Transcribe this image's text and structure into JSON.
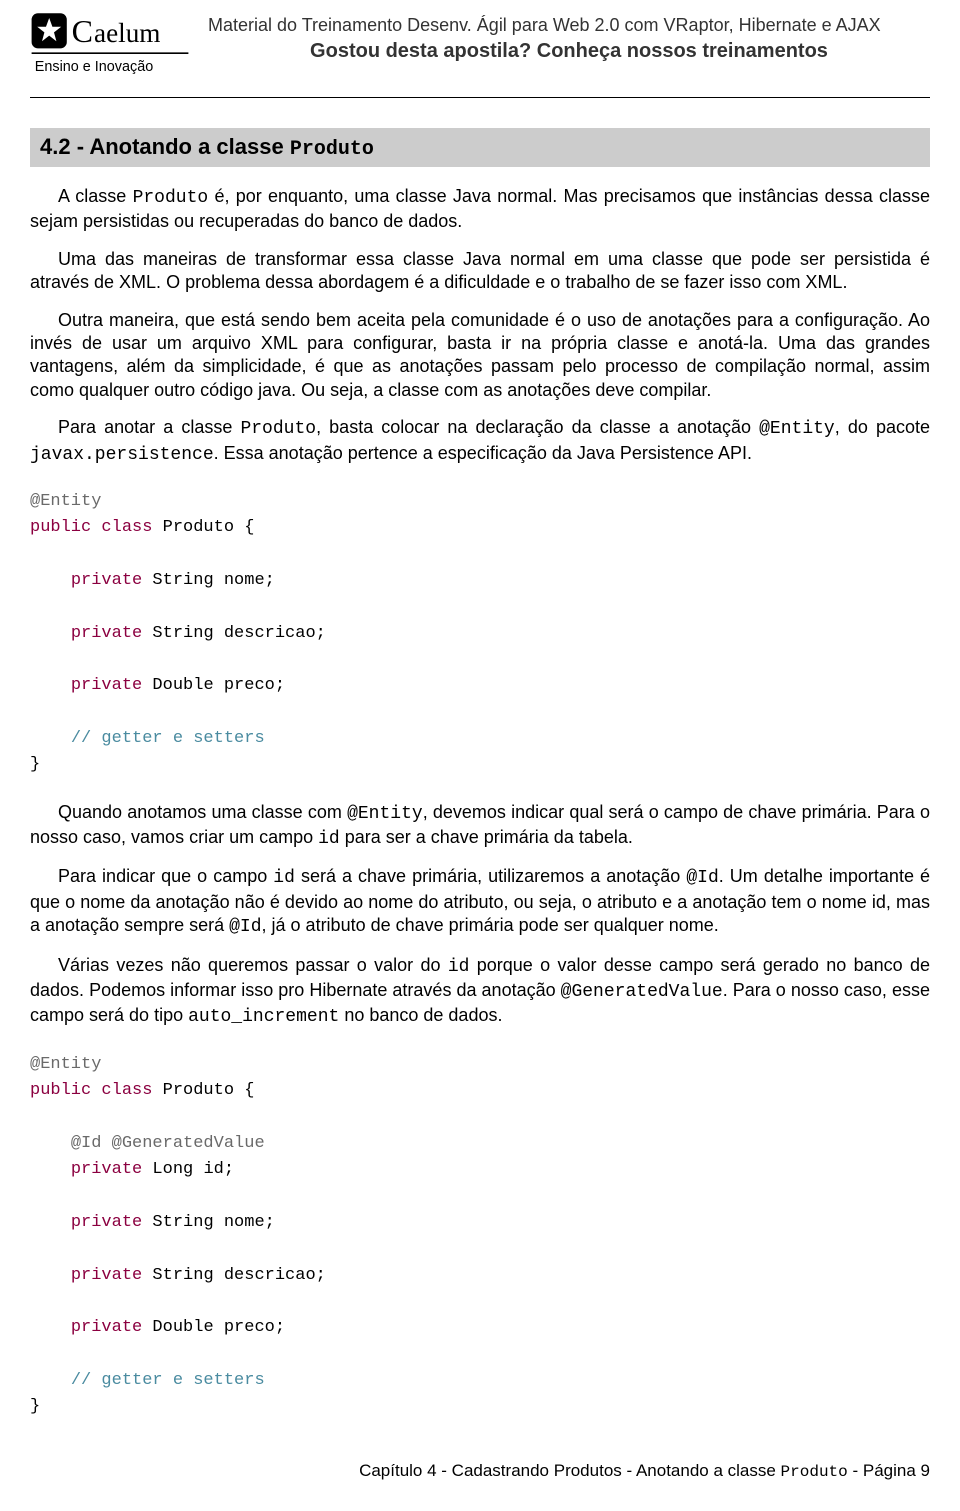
{
  "header": {
    "line1": "Material do Treinamento Desenv. Ágil para Web 2.0 com VRaptor, Hibernate e AJAX",
    "line2": "Gostou desta apostila? Conheça nossos treinamentos",
    "logo": {
      "brand": "Caelum",
      "tagline": "Ensino e Inovação"
    }
  },
  "section": {
    "num_title": "4.2 - Anotando a classe ",
    "title_mono": "Produto"
  },
  "para": {
    "p1a": "A classe ",
    "p1b": "Produto",
    "p1c": " é, por enquanto, uma classe Java normal. Mas precisamos que instâncias dessa classe sejam persistidas ou recuperadas do banco de dados.",
    "p2": "Uma das maneiras de transformar essa classe Java normal em uma classe que pode ser persistida é através de XML. O problema dessa abordagem é a dificuldade e o trabalho de se fazer isso com XML.",
    "p3": "Outra maneira, que está sendo bem aceita pela comunidade é o uso de anotações para a configuração. Ao invés de usar um arquivo XML para configurar, basta ir na própria classe e anotá-la. Uma das grandes vantagens, além da simplicidade, é que as anotações passam pelo processo de compilação normal, assim como qualquer outro código java. Ou seja, a classe com as anotações deve compilar.",
    "p4a": "Para anotar a classe ",
    "p4b": "Produto",
    "p4c": ", basta colocar na declaração da classe a anotação ",
    "p4d": "@Entity",
    "p4e": ", do pacote ",
    "p4f": "javax.persistence",
    "p4g": ". Essa anotação pertence a especificação da Java Persistence API.",
    "p5a": "Quando anotamos uma classe com ",
    "p5b": "@Entity",
    "p5c": ", devemos indicar qual será o campo de chave primária. Para o nosso caso, vamos criar um campo ",
    "p5d": "id",
    "p5e": " para ser a chave primária da tabela.",
    "p6a": "Para indicar que o campo ",
    "p6b": "id",
    "p6c": " será a chave primária, utilizaremos a anotação ",
    "p6d": "@Id",
    "p6e": ". Um detalhe importante é que o nome da anotação não é devido ao nome do atributo, ou seja, o atributo e a anotação tem o nome id, mas a anotação sempre será ",
    "p6f": "@Id",
    "p6g": ", já o atributo de chave primária pode ser qualquer nome.",
    "p7a": "Várias vezes não queremos passar o valor do ",
    "p7b": "id",
    "p7c": " porque o valor desse campo será gerado no banco de dados. Podemos informar isso pro Hibernate através da anotação ",
    "p7d": "@GeneratedValue",
    "p7e": ". Para o nosso caso, esse campo será do tipo ",
    "p7f": "auto_increment",
    "p7g": " no banco de dados."
  },
  "code1": {
    "l1_ann": "@Entity",
    "l2_kw": "public class",
    "l2_rest": " Produto {",
    "l3_kw": "private",
    "l3_rest": " String nome;",
    "l4_kw": "private",
    "l4_rest": " String descricao;",
    "l5_kw": "private",
    "l5_rest": " Double preco;",
    "l6_cmt": "// getter e setters",
    "l7": "}"
  },
  "code2": {
    "l1_ann": "@Entity",
    "l2_kw": "public class",
    "l2_rest": " Produto {",
    "l3_ann": "@Id @GeneratedValue",
    "l4_kw": "private",
    "l4_rest": " Long id;",
    "l5_kw": "private",
    "l5_rest": " String nome;",
    "l6_kw": "private",
    "l6_rest": " String descricao;",
    "l7_kw": "private",
    "l7_rest": " Double preco;",
    "l8_cmt": "// getter e setters",
    "l9": "}"
  },
  "footer": {
    "a": "Capítulo 4 - Cadastrando Produtos -  Anotando a classe ",
    "b": "Produto",
    "c": " - Página 9"
  }
}
